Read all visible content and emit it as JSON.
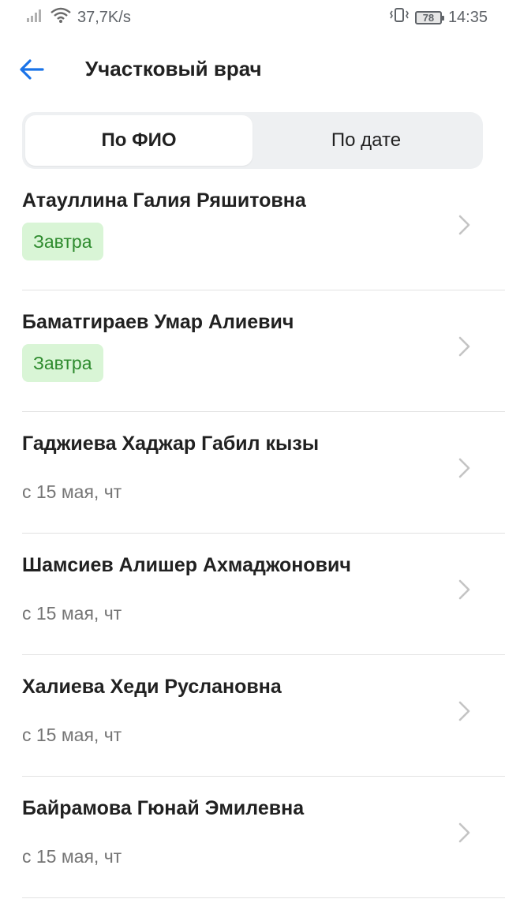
{
  "status_bar": {
    "speed": "37,7K/s",
    "battery": "78",
    "time": "14:35"
  },
  "header": {
    "title": "Участковый врач"
  },
  "tabs": [
    {
      "label": "По ФИО",
      "active": true
    },
    {
      "label": "По дате",
      "active": false
    }
  ],
  "doctors": [
    {
      "name": "Атауллина Галия Ряшитовна",
      "availability": "Завтра",
      "badge": true
    },
    {
      "name": "Баматгираев Умар Алиевич",
      "availability": "Завтра",
      "badge": true
    },
    {
      "name": "Гаджиева Хаджар Габил кызы",
      "availability": "с 15 мая, чт",
      "badge": false
    },
    {
      "name": "Шамсиев Алишер Ахмаджонович",
      "availability": "с 15 мая, чт",
      "badge": false
    },
    {
      "name": "Халиева Хеди Руслановна",
      "availability": "с 15 мая, чт",
      "badge": false
    },
    {
      "name": "Байрамова Гюнай Эмилевна",
      "availability": "с 15 мая, чт",
      "badge": false
    }
  ],
  "colors": {
    "accent": "#1a73e8",
    "badge_bg": "#d9f5d6",
    "badge_text": "#2e8b2e"
  }
}
